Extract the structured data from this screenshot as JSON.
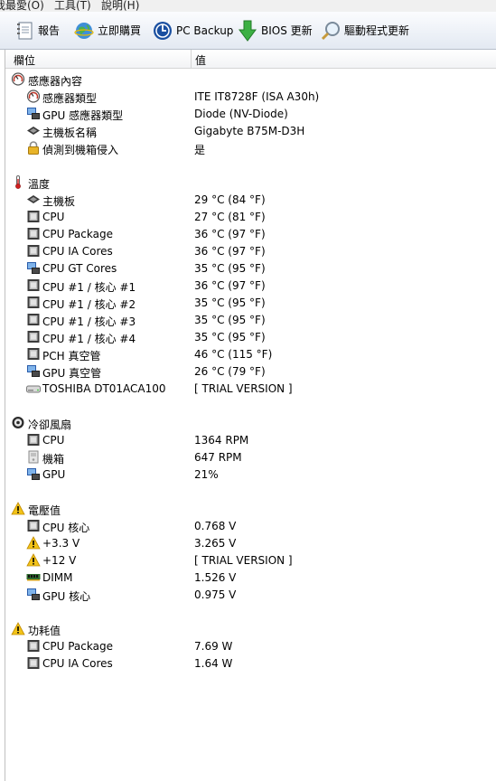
{
  "menu": [
    "我最愛(O)",
    "工具(T)",
    "說明(H)"
  ],
  "toolbar": {
    "report": "報告",
    "buy": "立即購買",
    "backup": "PC Backup",
    "bios": "BIOS 更新",
    "driver": "驅動程式更新"
  },
  "columns": {
    "field": "欄位",
    "value": "值"
  },
  "sections": [
    {
      "title": "感應器內容",
      "icon": "sensor-gauge-icon",
      "items": [
        {
          "label": "感應器類型",
          "value": "ITE IT8728F  (ISA A30h)",
          "icon": "sensor-gauge-icon"
        },
        {
          "label": "GPU 感應器類型",
          "value": "Diode  (NV-Diode)",
          "icon": "gpu-card-icon"
        },
        {
          "label": "主機板名稱",
          "value": "Gigabyte B75M-D3H",
          "icon": "motherboard-icon"
        },
        {
          "label": "偵測到機箱侵入",
          "value": "是",
          "icon": "padlock-icon"
        }
      ]
    },
    {
      "title": "溫度",
      "icon": "thermometer-icon",
      "items": [
        {
          "label": "主機板",
          "value": "29 °C  (84 °F)",
          "icon": "motherboard-icon"
        },
        {
          "label": "CPU",
          "value": "27 °C  (81 °F)",
          "icon": "cpu-chip-icon"
        },
        {
          "label": "CPU Package",
          "value": "36 °C  (97 °F)",
          "icon": "cpu-chip-icon"
        },
        {
          "label": "CPU IA Cores",
          "value": "36 °C  (97 °F)",
          "icon": "cpu-chip-icon"
        },
        {
          "label": "CPU GT Cores",
          "value": "35 °C  (95 °F)",
          "icon": "gpu-card-icon"
        },
        {
          "label": "CPU #1 / 核心 #1",
          "value": "36 °C  (97 °F)",
          "icon": "cpu-chip-icon"
        },
        {
          "label": "CPU #1 / 核心 #2",
          "value": "35 °C  (95 °F)",
          "icon": "cpu-chip-icon"
        },
        {
          "label": "CPU #1 / 核心 #3",
          "value": "35 °C  (95 °F)",
          "icon": "cpu-chip-icon"
        },
        {
          "label": "CPU #1 / 核心 #4",
          "value": "35 °C  (95 °F)",
          "icon": "cpu-chip-icon"
        },
        {
          "label": "PCH 真空管",
          "value": "46 °C  (115 °F)",
          "icon": "cpu-chip-icon"
        },
        {
          "label": "GPU 真空管",
          "value": "26 °C  (79 °F)",
          "icon": "gpu-card-icon"
        },
        {
          "label": "TOSHIBA DT01ACA100",
          "value": "[ TRIAL VERSION ]",
          "icon": "hard-drive-icon"
        }
      ]
    },
    {
      "title": "冷卻風扇",
      "icon": "fan-icon",
      "items": [
        {
          "label": "CPU",
          "value": "1364 RPM",
          "icon": "cpu-chip-icon"
        },
        {
          "label": "機箱",
          "value": "647 RPM",
          "icon": "chassis-icon"
        },
        {
          "label": "GPU",
          "value": "21%",
          "icon": "gpu-card-icon"
        }
      ]
    },
    {
      "title": "電壓值",
      "icon": "warning-icon",
      "items": [
        {
          "label": "CPU 核心",
          "value": "0.768 V",
          "icon": "cpu-chip-icon"
        },
        {
          "label": "+3.3 V",
          "value": "3.265 V",
          "icon": "warning-icon"
        },
        {
          "label": "+12 V",
          "value": "[ TRIAL VERSION ]",
          "icon": "warning-icon"
        },
        {
          "label": "DIMM",
          "value": "1.526 V",
          "icon": "memory-module-icon"
        },
        {
          "label": "GPU 核心",
          "value": "0.975 V",
          "icon": "gpu-card-icon"
        }
      ]
    },
    {
      "title": "功耗值",
      "icon": "warning-icon",
      "items": [
        {
          "label": "CPU Package",
          "value": "7.69 W",
          "icon": "cpu-chip-icon"
        },
        {
          "label": "CPU IA Cores",
          "value": "1.64 W",
          "icon": "cpu-chip-icon"
        }
      ]
    }
  ]
}
